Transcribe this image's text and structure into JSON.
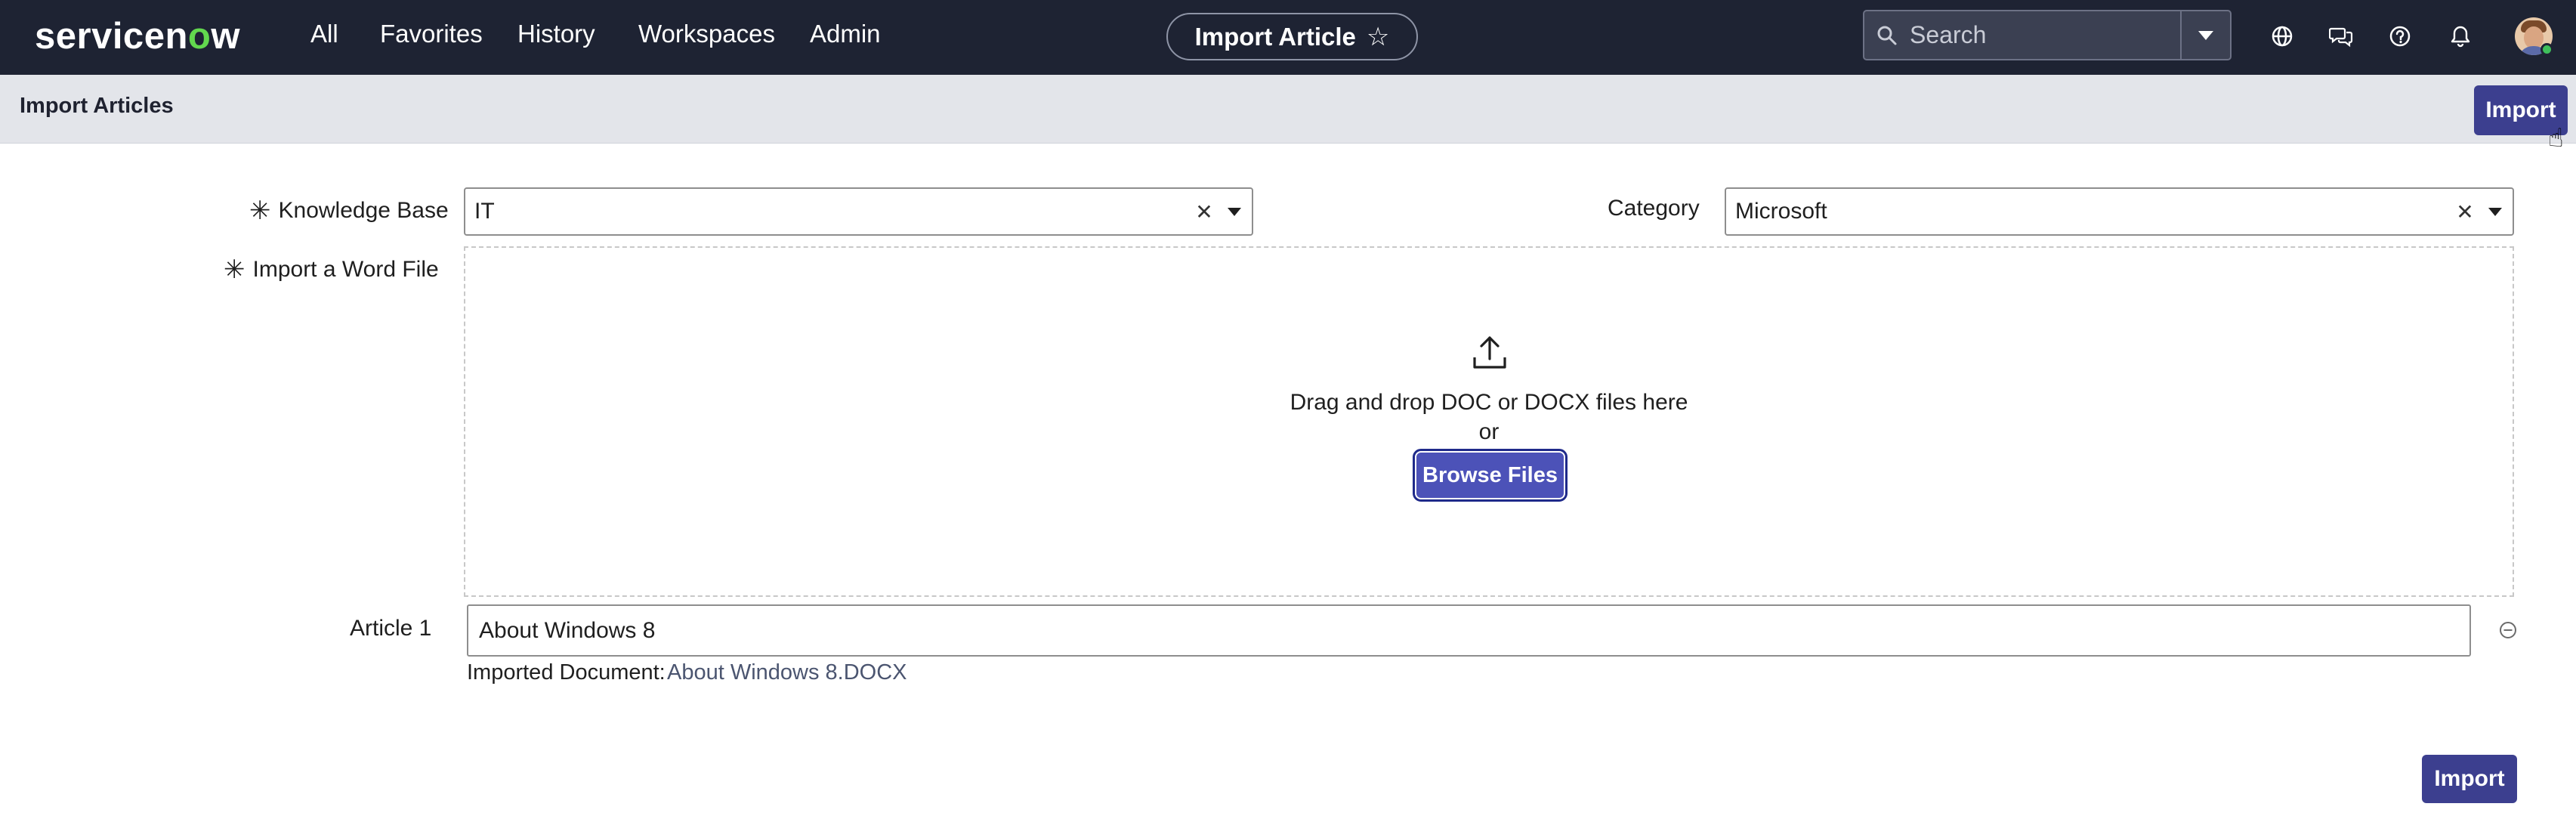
{
  "brand": {
    "logo_text_before": "servicen",
    "logo_text_accent": "o",
    "logo_text_after": "w"
  },
  "nav": {
    "items": [
      "All",
      "Favorites",
      "History",
      "Workspaces",
      "Admin"
    ]
  },
  "context": {
    "title": "Import Article"
  },
  "search": {
    "placeholder": "Search"
  },
  "page": {
    "title": "Import Articles",
    "import_label": "Import"
  },
  "form": {
    "knowledge_base": {
      "label": "Knowledge Base",
      "value": "IT"
    },
    "category": {
      "label": "Category",
      "value": "Microsoft"
    },
    "word_file": {
      "label": "Import a Word File"
    },
    "dropzone": {
      "primary_text": "Drag and drop DOC or DOCX files here",
      "or_text": "or",
      "browse_label": "Browse Files"
    },
    "article": {
      "label": "Article 1",
      "value": "About Windows 8",
      "imported_label": "Imported Document:",
      "imported_file": "About Windows 8.DOCX"
    },
    "submit_label": "Import"
  },
  "colors": {
    "header_bg": "#1e2333",
    "primary": "#3c3f8f",
    "logo_accent": "#62d84e",
    "subheader_bg": "#e3e5ea"
  }
}
